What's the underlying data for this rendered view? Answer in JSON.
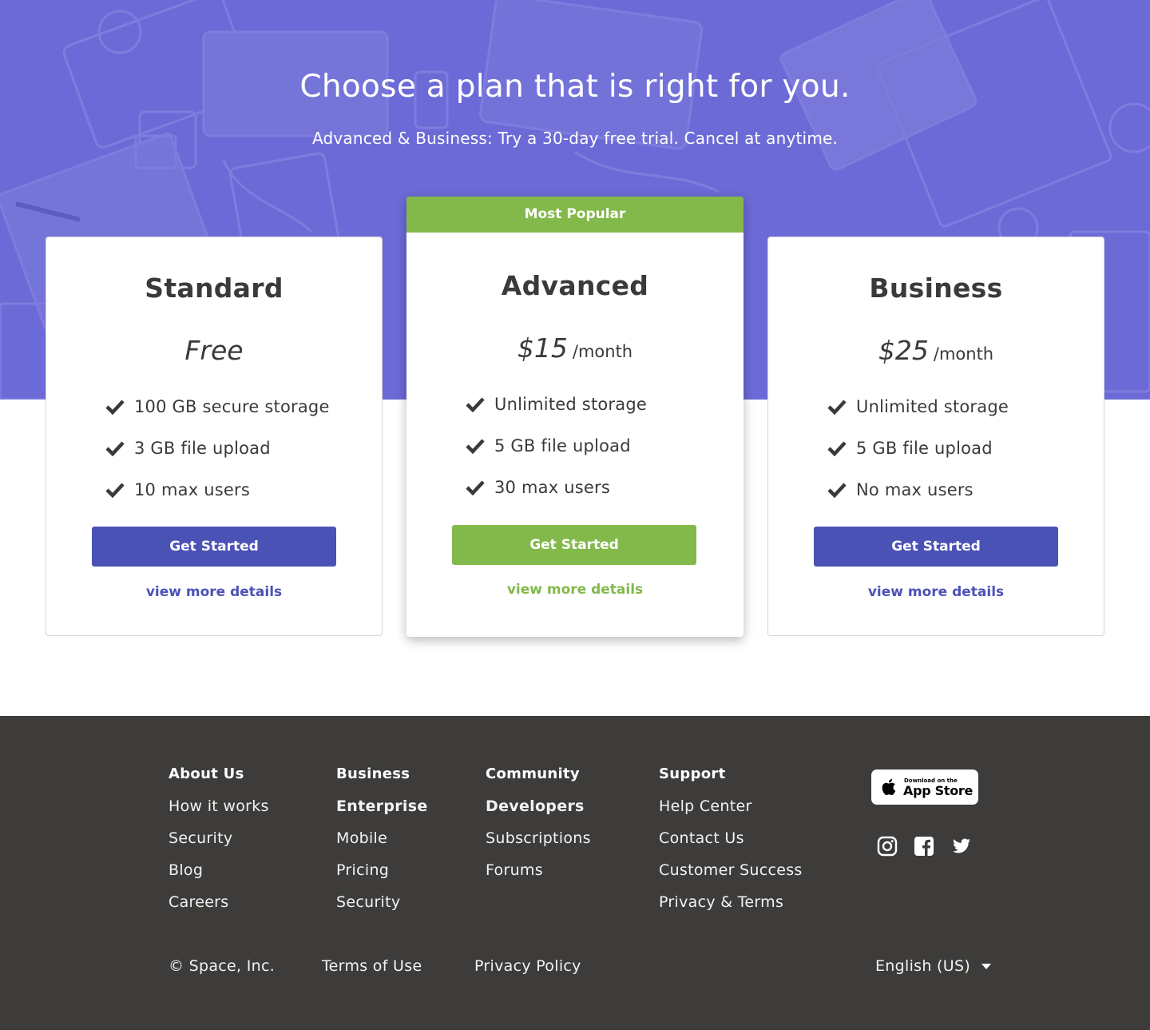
{
  "hero": {
    "title": "Choose a plan that is right for you.",
    "subtitle": "Advanced & Business: Try a 30-day free trial. Cancel at anytime.",
    "overlay_color": "#6c6ad6"
  },
  "plans": [
    {
      "name": "Standard",
      "price": "Free",
      "period": "",
      "features": [
        "100 GB secure storage",
        "3 GB file upload",
        "10 max users"
      ],
      "cta": "Get Started",
      "details": "view more details",
      "accent": "#4b52b6"
    },
    {
      "name": "Advanced",
      "badge": "Most Popular",
      "price": "$15",
      "period": "/month",
      "features": [
        "Unlimited storage",
        "5 GB file upload",
        "30 max users"
      ],
      "cta": "Get Started",
      "details": "view more details",
      "accent": "#82b94a"
    },
    {
      "name": "Business",
      "price": "$25",
      "period": "/month",
      "features": [
        "Unlimited storage",
        "5 GB file upload",
        "No max users"
      ],
      "cta": "Get Started",
      "details": "view more details",
      "accent": "#4b52b6"
    }
  ],
  "footer": {
    "columns": [
      {
        "heading": "About  Us",
        "items": [
          "How it works",
          "Security",
          "Blog",
          "Careers"
        ]
      },
      {
        "heading": "Business",
        "items": [
          "Enterprise",
          "Mobile",
          "Pricing",
          "Security"
        ]
      },
      {
        "heading": "Community",
        "items": [
          "Developers",
          "Subscriptions",
          "Forums"
        ]
      },
      {
        "heading": "Support",
        "items": [
          "Help Center",
          "Contact Us",
          "Customer Success",
          "Privacy & Terms"
        ]
      }
    ],
    "appstore": {
      "small": "Download on the",
      "big": "App Store"
    },
    "social": [
      "instagram-icon",
      "facebook-icon",
      "twitter-icon"
    ],
    "copyright": "© Space, Inc.",
    "terms": "Terms of Use",
    "privacy": "Privacy Policy",
    "language": "English (US)",
    "background": "#3d3c3a"
  }
}
